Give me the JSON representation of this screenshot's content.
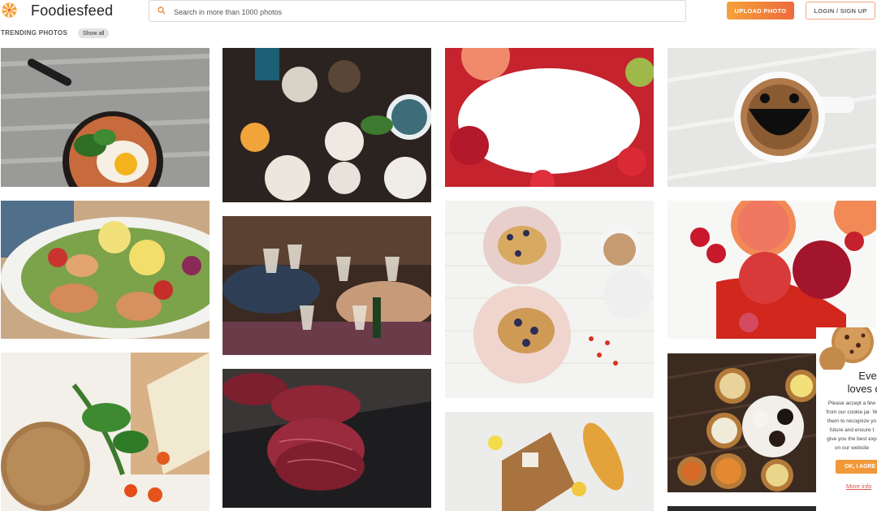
{
  "header": {
    "logo_text": "Foodiesfeed",
    "search_placeholder": "Search in more than 1000 photos",
    "upload_label": "UPLOAD PHOTO",
    "login_label": "LOGIN / SIGN UP",
    "accent_color": "#f08a3a"
  },
  "section": {
    "title": "TRENDING PHOTOS",
    "show_all_label": "Show all"
  },
  "photos": [
    {
      "subject": "skillet with fried egg and spinach"
    },
    {
      "subject": "table of dishes from above"
    },
    {
      "subject": "frame of red fruits around white space"
    },
    {
      "subject": "smiling coffee cup"
    },
    {
      "subject": "salmon salad with lemon"
    },
    {
      "subject": "people toasting wine glasses"
    },
    {
      "subject": "waffles with blueberries and tea"
    },
    {
      "subject": "grapefruit, apples and goji berries"
    },
    {
      "subject": "sourdough bread with herbs and cheese"
    },
    {
      "subject": "raw beef steak"
    },
    {
      "subject": "cheese board with baguette and lemon"
    },
    {
      "subject": "dim sum steamer baskets"
    }
  ],
  "cookie_popup": {
    "title_line1": "Everyon",
    "title_line2": "loves cook",
    "body_lines": [
      "Please accept a few",
      "from our cookie jar. W",
      "them to recognize yo",
      "future and ensure t",
      "give you the best exp",
      "on our website"
    ],
    "ok_label": "OK, I AGRE",
    "more_info_label": "More info"
  }
}
